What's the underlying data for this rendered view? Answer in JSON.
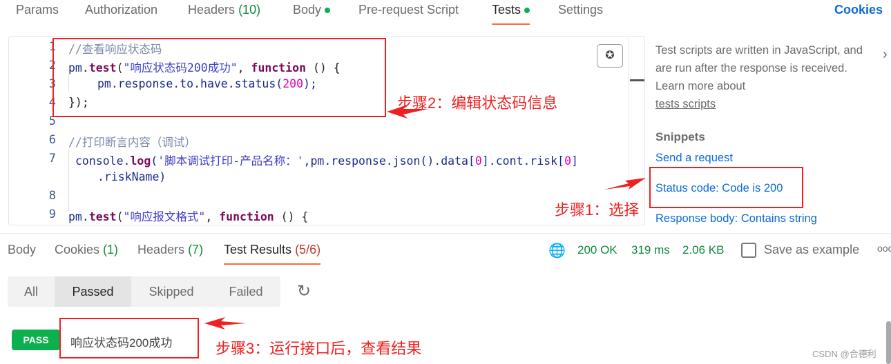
{
  "request_tabs": [
    {
      "label": "Params"
    },
    {
      "label": "Authorization"
    },
    {
      "label": "Headers",
      "count": "(10)"
    },
    {
      "label": "Body",
      "dot": true
    },
    {
      "label": "Pre-request Script"
    },
    {
      "label": "Tests",
      "dot": true,
      "active": true
    },
    {
      "label": "Settings"
    }
  ],
  "cookies_link": "Cookies",
  "editor": {
    "line_numbers": [
      "1",
      "2",
      "3",
      "4",
      "5",
      "6",
      "7",
      "8",
      "9"
    ],
    "l1": "//查看响应状态码",
    "l2a": "pm",
    "l2b": ".",
    "l2c": "test",
    "l2d": "(",
    "l2e": "\"响应状态码200成功\"",
    "l2f": ", ",
    "l2g": "function",
    "l2h": " () {",
    "l3a": "pm.response.to.have.status(",
    "l3b": "200",
    "l3c": ");",
    "l4": "});",
    "l6": "//打印断言内容（调试）",
    "l7a": "console.",
    "l7b": "log",
    "l7c": "(",
    "l7d": "'脚本调试打印-产品名称：'",
    "l7e": ",pm.response.json().data[",
    "l7f": "0",
    "l7g": "].cont.risk[",
    "l7h": "0",
    "l7i": "]",
    "l7cont": ".riskName)",
    "l9a": "pm",
    "l9b": ".",
    "l9c": "test",
    "l9d": "(",
    "l9e": "\"响应报文格式\"",
    "l9f": ", ",
    "l9g": "function",
    "l9h": " () {"
  },
  "sidebar": {
    "description": "Test scripts are written in JavaScript, and are run after the response is received. Learn more about",
    "link": "tests scripts",
    "snippets_title": "Snippets",
    "snippets": [
      "Send a request",
      "Status code: Code is 200",
      "Response body: Contains string"
    ]
  },
  "response_tabs": [
    {
      "label": "Body"
    },
    {
      "label": "Cookies",
      "count": "(1)"
    },
    {
      "label": "Headers",
      "count": "(7)"
    },
    {
      "label": "Test Results",
      "count": "(5/6)",
      "active": true
    }
  ],
  "status": {
    "code": "200 OK",
    "time": "319 ms",
    "size": "2.06 KB",
    "save": "Save as example"
  },
  "filters": [
    {
      "label": "All"
    },
    {
      "label": "Passed",
      "active": true
    },
    {
      "label": "Skipped"
    },
    {
      "label": "Failed"
    }
  ],
  "result": {
    "badge": "PASS",
    "name": "响应状态码200成功"
  },
  "annotations": {
    "step1": "步骤1：选择",
    "step2": "步骤2：编辑状态码信息",
    "step3": "步骤3：运行接口后，查看结果"
  },
  "watermark": "CSDN @合德利",
  "colors": {
    "accent": "#ff6c37",
    "pass": "#0cb04f",
    "link": "#0a6bd8",
    "annotation": "#f02020",
    "status_green": "#0f8a3c"
  }
}
